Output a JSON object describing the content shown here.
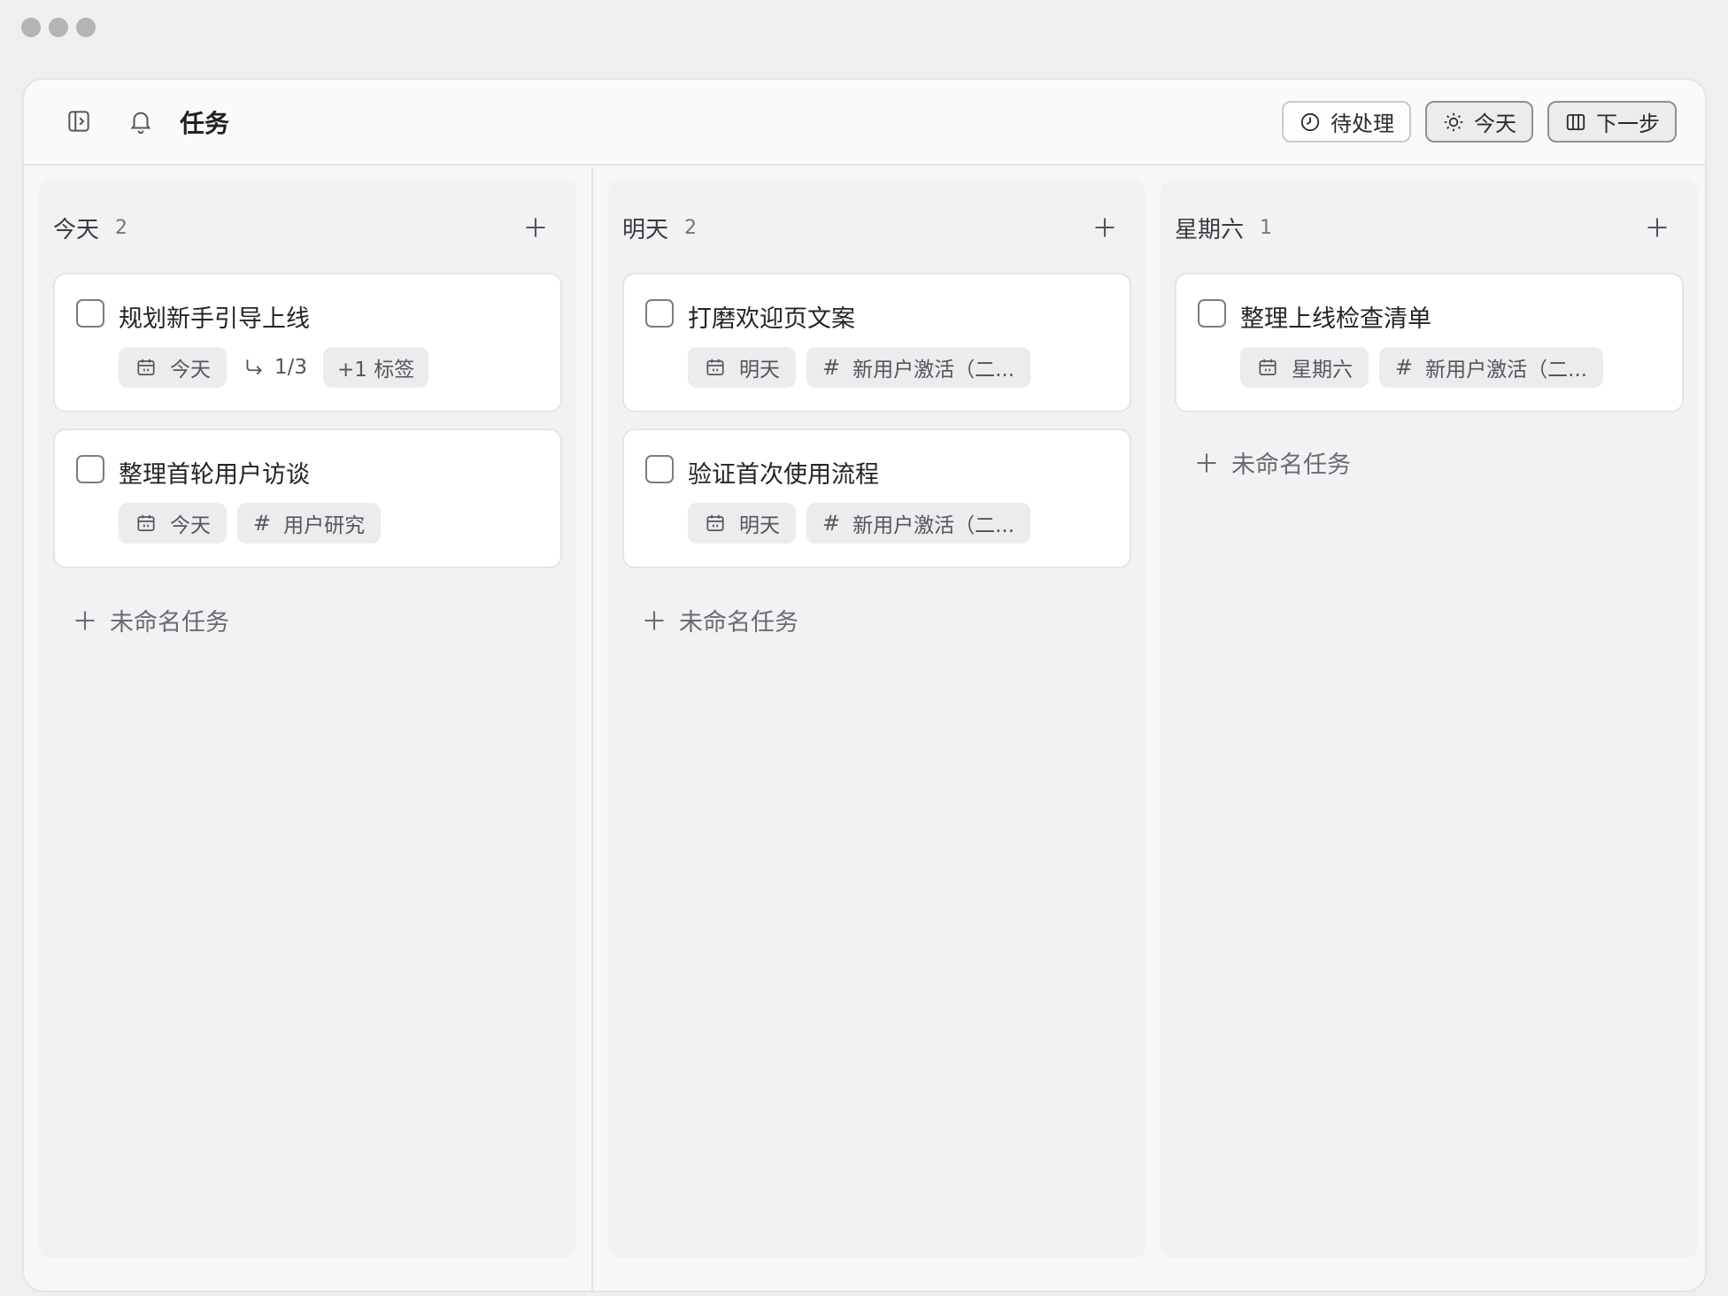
{
  "header": {
    "title": "任务",
    "views": [
      {
        "label": "待处理",
        "icon": "clock-icon"
      },
      {
        "label": "今天",
        "icon": "sun-icon"
      },
      {
        "label": "下一步",
        "icon": "columns-icon"
      }
    ]
  },
  "columns": [
    {
      "title": "今天",
      "count": "2",
      "cards": [
        {
          "title": "规划新手引导上线",
          "date": "今天",
          "subtasks": "1/3",
          "tag": "+1 标签"
        },
        {
          "title": "整理首轮用户访谈",
          "date": "今天",
          "tag": "用户研究"
        }
      ],
      "new_task": "未命名任务"
    },
    {
      "title": "明天",
      "count": "2",
      "cards": [
        {
          "title": "打磨欢迎页文案",
          "date": "明天",
          "tag": "新用户激活（二..."
        },
        {
          "title": "验证首次使用流程",
          "date": "明天",
          "tag": "新用户激活（二..."
        }
      ],
      "new_task": "未命名任务"
    },
    {
      "title": "星期六",
      "count": "1",
      "cards": [
        {
          "title": "整理上线检查清单",
          "date": "星期六",
          "tag": "新用户激活（二..."
        }
      ],
      "new_task": "未命名任务"
    }
  ]
}
